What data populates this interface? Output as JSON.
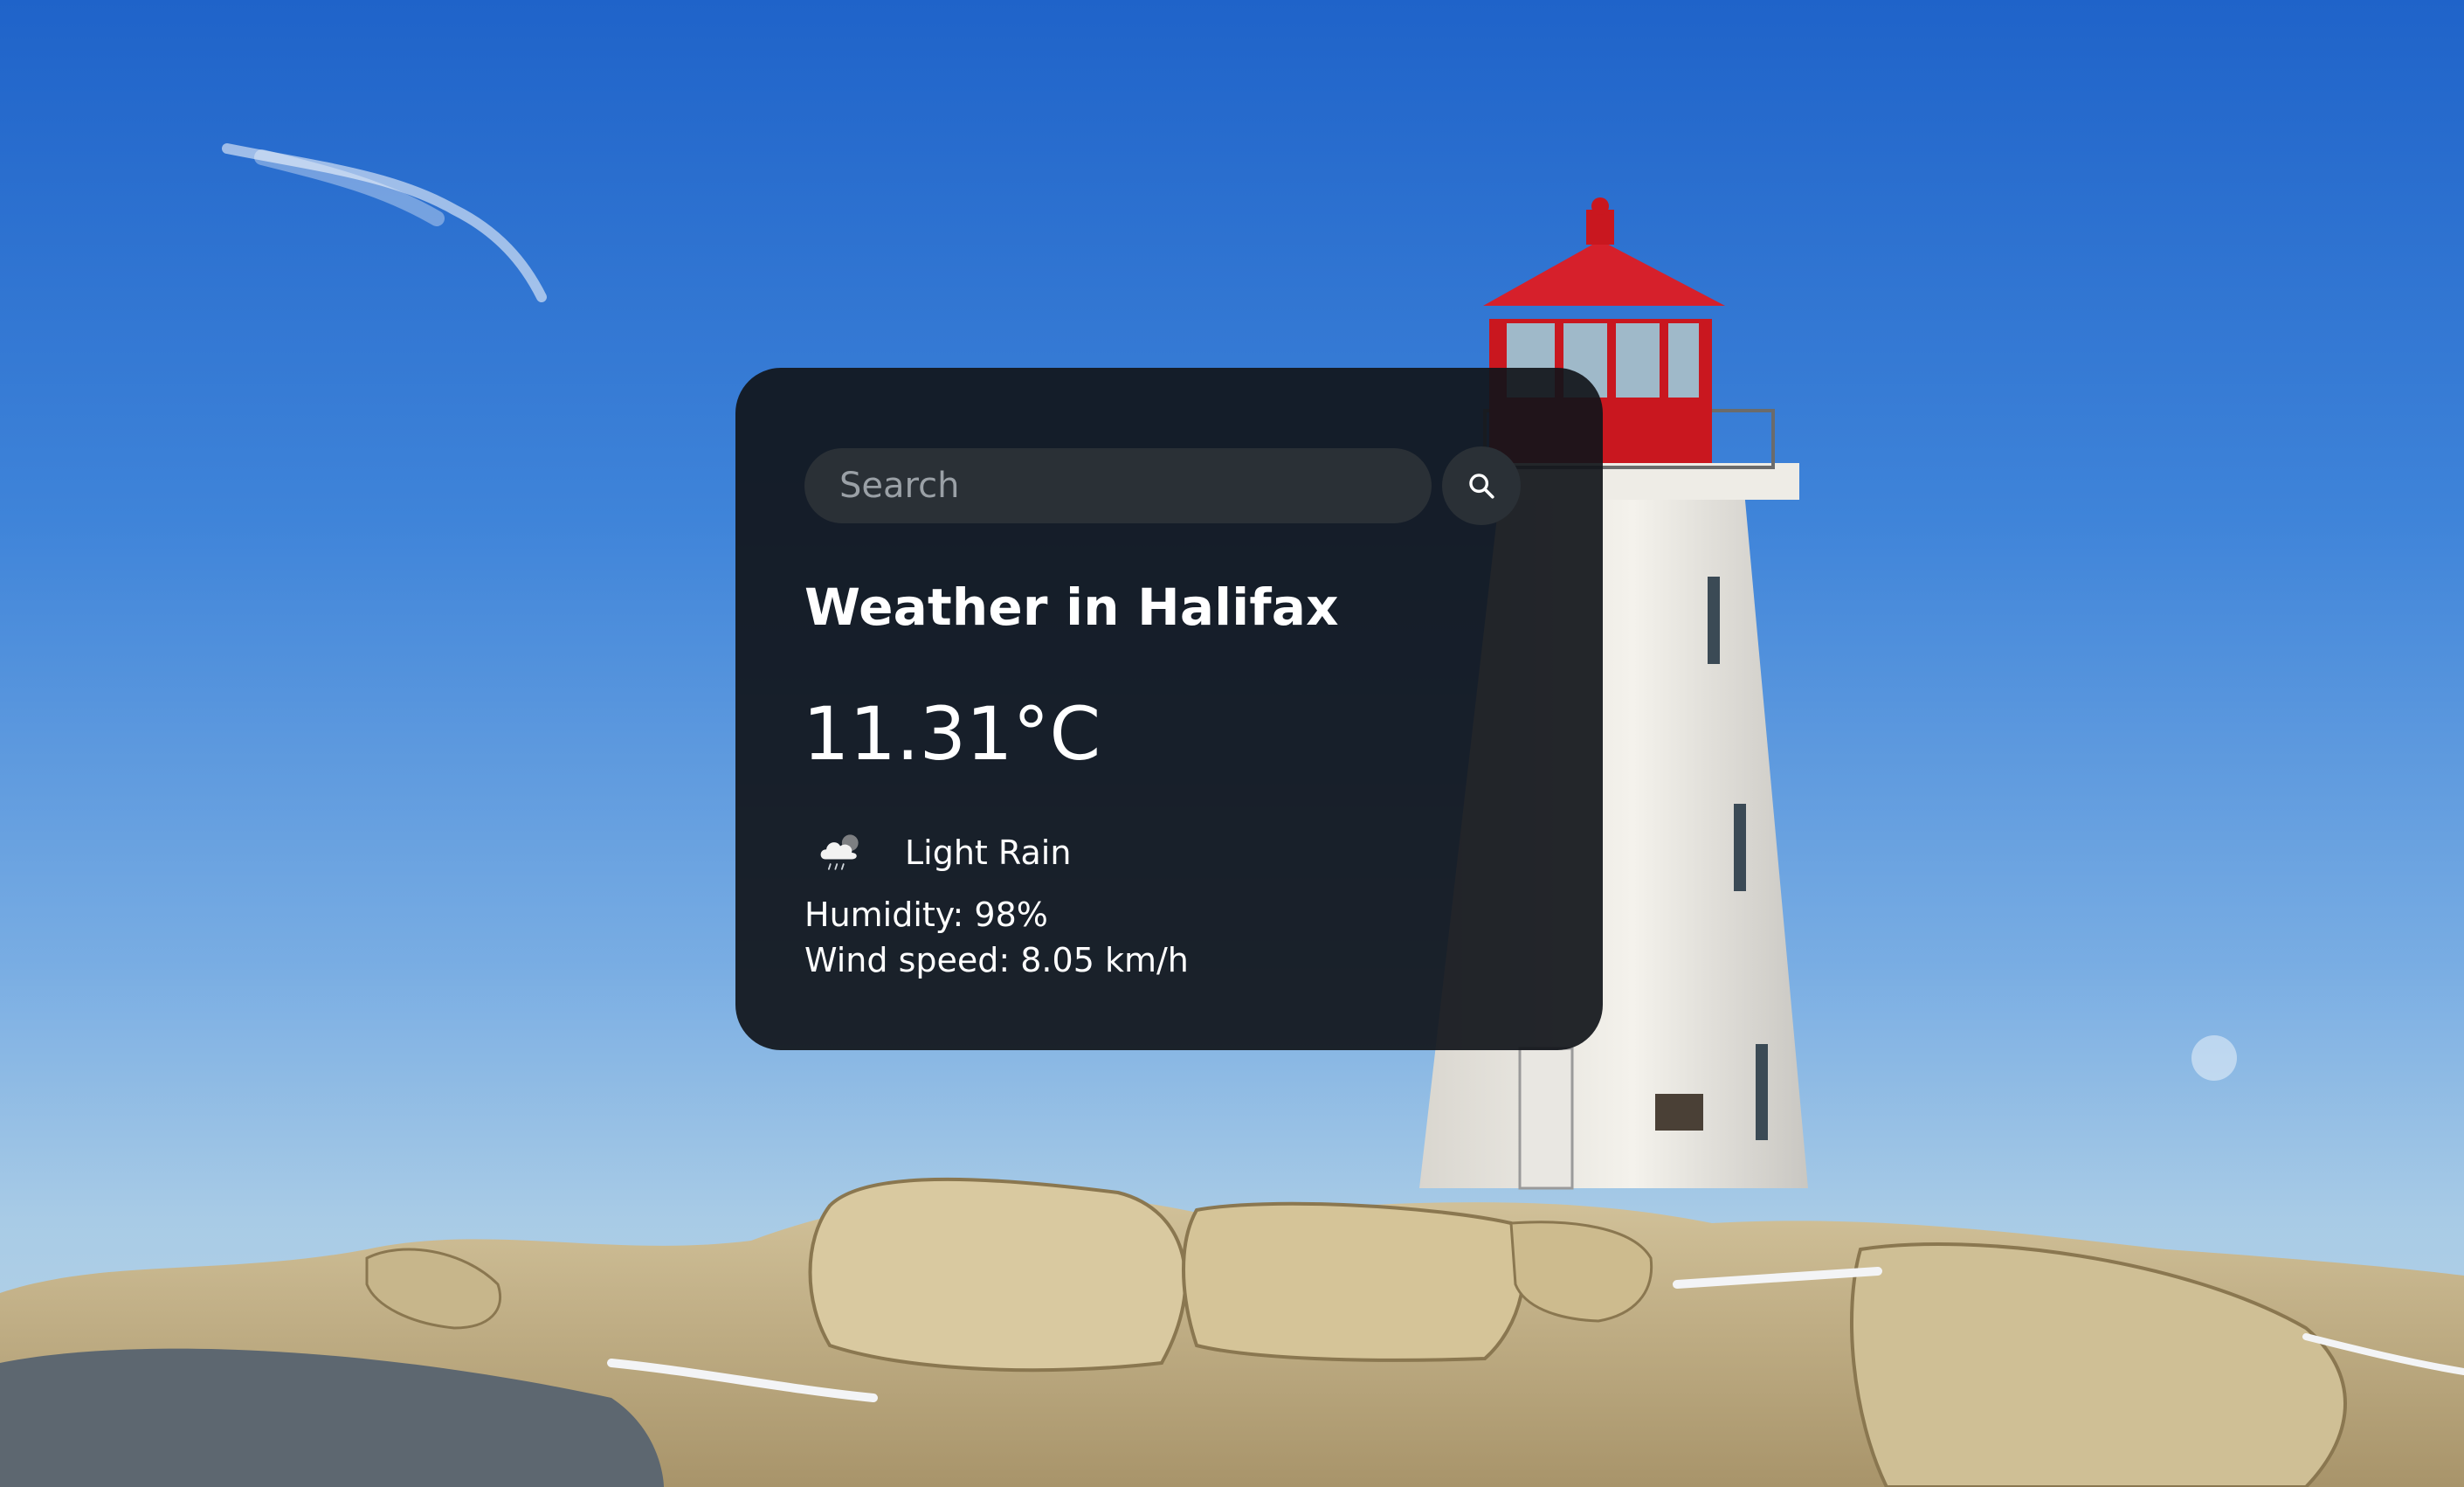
{
  "search": {
    "placeholder": "Search",
    "value": "",
    "button_icon": "search-icon"
  },
  "weather": {
    "title": "Weather in Halifax",
    "temperature": "11.31°C",
    "condition": "Light Rain",
    "condition_icon": "cloud-rain-icon",
    "humidity": "Humidity: 98%",
    "wind": "Wind speed: 8.05 km/h"
  },
  "colors": {
    "card_background": "#11151a",
    "input_background": "#2a3036",
    "text": "#ffffff",
    "placeholder": "#9aa0a6",
    "lighthouse_red": "#d6202b"
  }
}
